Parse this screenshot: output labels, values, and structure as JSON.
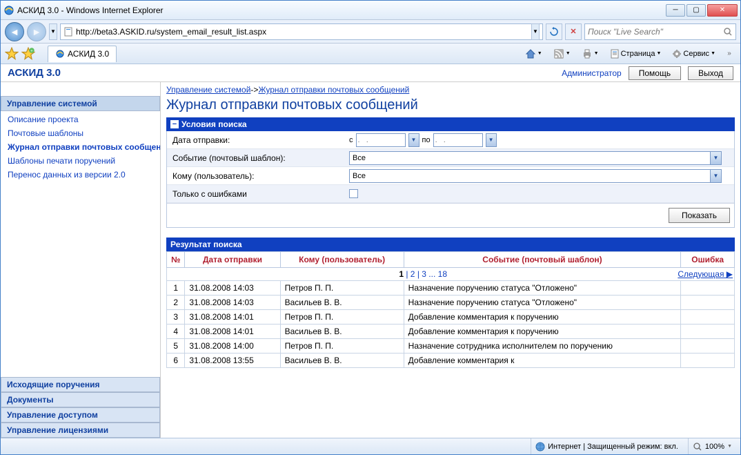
{
  "window": {
    "title": "АСКИД 3.0 - Windows Internet Explorer"
  },
  "nav": {
    "url": "http://beta3.ASKID.ru/system_email_result_list.aspx",
    "search_placeholder": "Поиск \"Live Search\""
  },
  "tab": {
    "title": "АСКИД 3.0"
  },
  "toolbar": {
    "page": "Страница",
    "service": "Сервис"
  },
  "app": {
    "title": "АСКИД 3.0",
    "admin": "Администратор",
    "help": "Помощь",
    "exit": "Выход"
  },
  "sidebar": {
    "sections": {
      "sys": "Управление системой",
      "out": "Исходящие поручения",
      "docs": "Документы",
      "access": "Управление доступом",
      "lic": "Управление лицензиями"
    },
    "items": [
      "Описание проекта",
      "Почтовые шаблоны",
      "Журнал отправки почтовых сообщений",
      "Шаблоны печати поручений",
      "Перенос данных из версии 2.0"
    ]
  },
  "breadcrumb": {
    "a": "Управление системой",
    "b": "Журнал отправки почтовых сообщений"
  },
  "page_title": "Журнал отправки почтовых сообщений",
  "search": {
    "header": "Условия поиска",
    "labels": {
      "date": "Дата отправки:",
      "from": "с",
      "to": "по",
      "event": "Событие (почтовый шаблон):",
      "user": "Кому (пользователь):",
      "errors": "Только с ошибками",
      "date_placeholder": ".   .",
      "all": "Все"
    },
    "show_btn": "Показать"
  },
  "results": {
    "header": "Результат поиска",
    "cols": {
      "num": "№",
      "date": "Дата отправки",
      "user": "Кому (пользователь)",
      "event": "Событие (почтовый шаблон)",
      "error": "Ошибка"
    },
    "pager": {
      "pages": [
        "1",
        "2",
        "3",
        "18"
      ],
      "current": "1",
      "next": "Следующая"
    },
    "rows": [
      {
        "n": "1",
        "date": "31.08.2008 14:03",
        "user": "Петров П. П.",
        "event": "Назначение поручению статуса \"Отложено\"",
        "err": ""
      },
      {
        "n": "2",
        "date": "31.08.2008 14:03",
        "user": "Васильев В. В.",
        "event": "Назначение поручению статуса \"Отложено\"",
        "err": ""
      },
      {
        "n": "3",
        "date": "31.08.2008 14:01",
        "user": "Петров П. П.",
        "event": "Добавление комментария к поручению",
        "err": ""
      },
      {
        "n": "4",
        "date": "31.08.2008 14:01",
        "user": "Васильев В. В.",
        "event": "Добавление комментария к поручению",
        "err": ""
      },
      {
        "n": "5",
        "date": "31.08.2008 14:00",
        "user": "Петров П. П.",
        "event": "Назначение сотрудника исполнителем по поручению",
        "err": ""
      },
      {
        "n": "6",
        "date": "31.08.2008 13:55",
        "user": "Васильев В. В.",
        "event": "Добавление комментария к",
        "err": ""
      }
    ]
  },
  "status": {
    "mode": "Интернет | Защищенный режим: вкл.",
    "zoom": "100%"
  }
}
